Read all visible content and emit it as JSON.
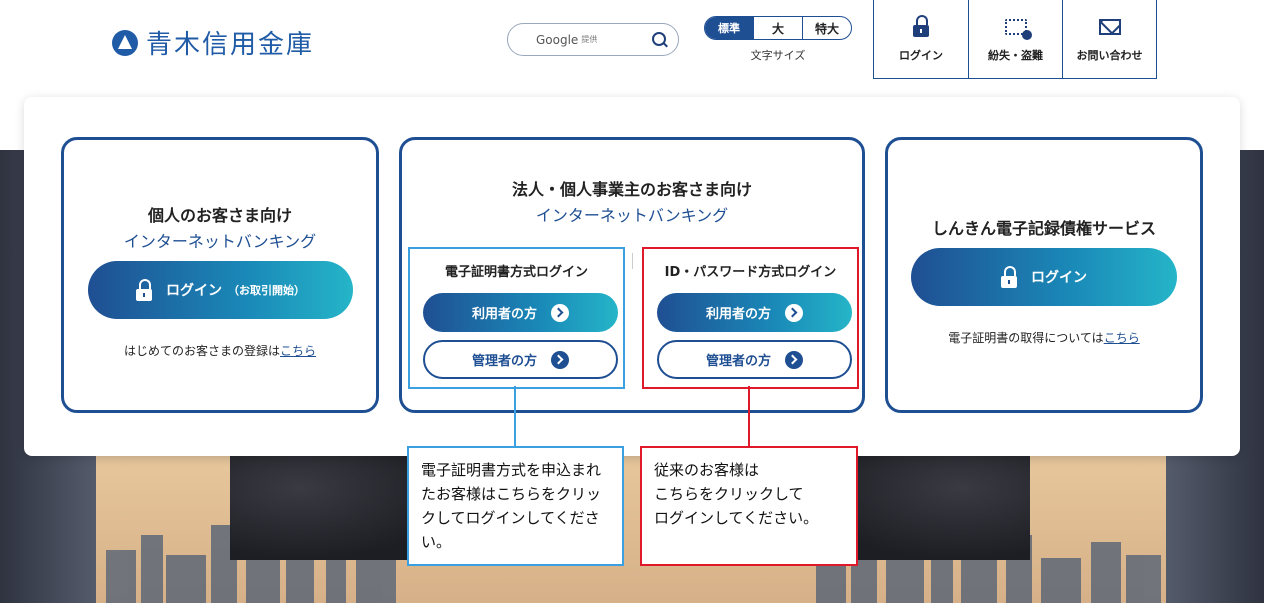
{
  "header": {
    "bank_name": "青木信用金庫",
    "search": {
      "label": "Google",
      "sub": "提供"
    },
    "font_size": {
      "label": "文字サイズ",
      "options": [
        "標準",
        "大",
        "特大"
      ]
    },
    "nav": [
      {
        "label": "ログイン",
        "icon": "lock-icon"
      },
      {
        "label": "紛失・盗難",
        "icon": "card-alert-icon"
      },
      {
        "label": "お問い合わせ",
        "icon": "mail-icon"
      }
    ]
  },
  "personal": {
    "title": "個人のお客さま向け",
    "subtitle": "インターネットバンキング",
    "login_label": "ログイン",
    "login_sub": "（お取引開始）",
    "note_prefix": "はじめてのお客さまの登録は",
    "note_link": "こちら"
  },
  "corporate": {
    "title": "法人・個人事業主のお客さま向け",
    "subtitle": "インターネットバンキング",
    "cert": {
      "title": "電子証明書方式ログイン",
      "user_button": "利用者の方",
      "admin_button": "管理者の方"
    },
    "idpw": {
      "title": "ID・パスワード方式ログイン",
      "user_button": "利用者の方",
      "admin_button": "管理者の方"
    }
  },
  "densai": {
    "title": "しんきん電子記録債権サービス",
    "login_label": "ログイン",
    "note_prefix": "電子証明書の取得については",
    "note_link": "こちら"
  },
  "callouts": {
    "cert": "電子証明書方式を申込まれたお客様はこちらをクリックしてログインしてください。",
    "idpw_line1": "従来のお客様は",
    "idpw_line2": "こちらをクリックして",
    "idpw_line3": "ログインしてください。"
  },
  "colors": {
    "brand": "#1f4f93",
    "accent_gradient_end": "#25b5c8",
    "callout_blue": "#3ba0e0",
    "callout_red": "#e0192a"
  }
}
